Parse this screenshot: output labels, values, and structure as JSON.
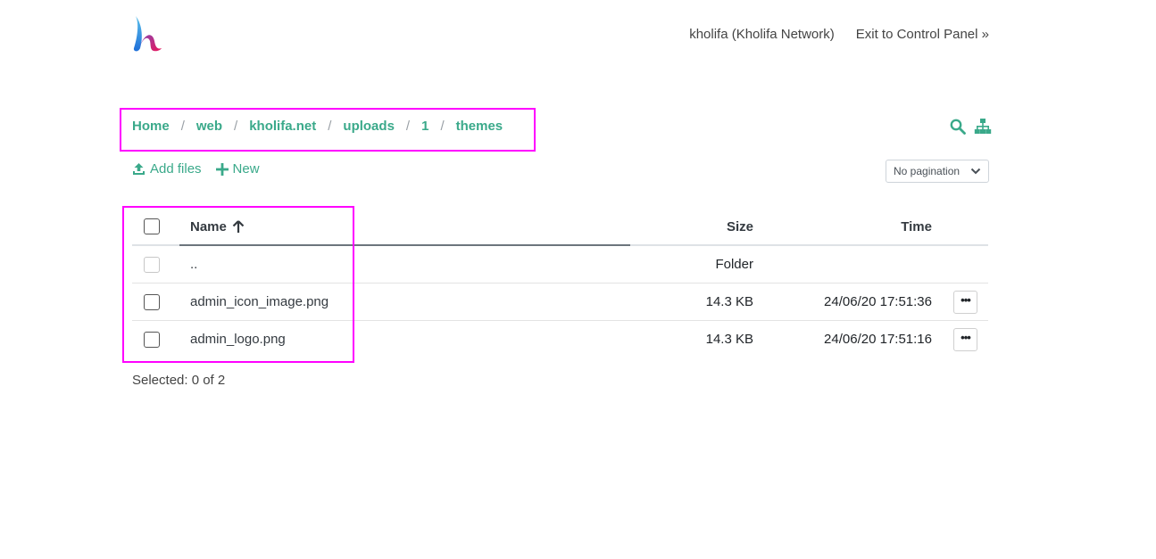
{
  "header": {
    "user_label": "kholifa (Kholifa Network)",
    "exit_label": "Exit to Control Panel »"
  },
  "breadcrumb": [
    "Home",
    "web",
    "kholifa.net",
    "uploads",
    "1",
    "themes"
  ],
  "breadcrumb_separator": "/",
  "toolbar": {
    "add_files_label": "Add files",
    "new_label": "New",
    "pagination_value": "No pagination"
  },
  "table": {
    "columns": {
      "name": "Name",
      "size": "Size",
      "time": "Time"
    },
    "rows": [
      {
        "name": "..",
        "size": "Folder",
        "time": ""
      },
      {
        "name": "admin_icon_image.png",
        "size": "14.3 KB",
        "time": "24/06/20 17:51:36"
      },
      {
        "name": "admin_logo.png",
        "size": "14.3 KB",
        "time": "24/06/20 17:51:16"
      }
    ]
  },
  "footer": {
    "selected_text": "Selected: 0 of 2"
  },
  "colors": {
    "accent": "#3aa98a",
    "highlight": "#ff00ff"
  }
}
